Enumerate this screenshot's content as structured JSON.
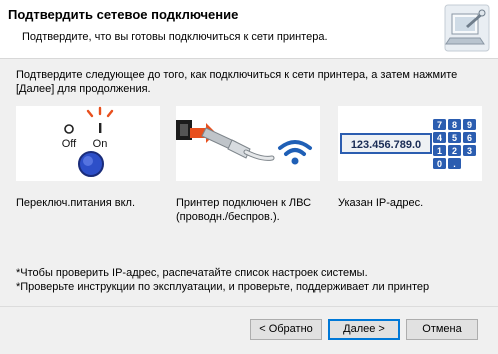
{
  "header": {
    "title": "Подтвердить сетевое подключение",
    "subtitle": "Подтвердите, что вы готовы подключиться к сети принтера."
  },
  "intro": {
    "line1": "Подтвердите следующее до того, как подключиться к сети принтера, а затем нажмите",
    "line2": "[Далее] для продолжения."
  },
  "cards": {
    "power": {
      "off_label": "Off",
      "on_label": "On",
      "caption": "Переключ.питания вкл."
    },
    "lan": {
      "caption_line1": "Принтер подключен к ЛВС",
      "caption_line2": "(проводн./беспров.)."
    },
    "ip": {
      "address": "123.456.789.0",
      "keys": [
        "7",
        "8",
        "9",
        "4",
        "5",
        "6",
        "1",
        "2",
        "3",
        "0",
        "."
      ],
      "caption": "Указан IP-адрес."
    }
  },
  "notes": {
    "line1": "*Чтобы проверить IP-адрес, распечатайте список настроек системы.",
    "line2": "*Проверьте инструкции по эксплуатации, и проверьте, поддерживает ли принтер"
  },
  "buttons": {
    "back": "< Обратно",
    "next": "Далее >",
    "cancel": "Отмена"
  },
  "colors": {
    "accent_blue": "#0078d7",
    "power_blue": "#2d4fc8",
    "alert_orange": "#e8501e",
    "key_blue": "#2b5db0"
  }
}
